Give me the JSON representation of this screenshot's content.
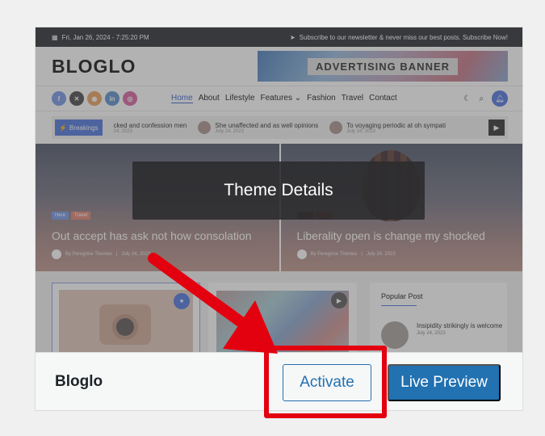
{
  "topbar": {
    "datetime": "Fri, Jan 26, 2024 - 7:25:20 PM",
    "newsletter": "Subscribe to our newsletter & never miss our best posts. Subscribe Now!"
  },
  "site": {
    "logo": "BLOGLO",
    "ad_label": "ADVERTISING BANNER"
  },
  "socials": [
    {
      "icon": "facebook-icon",
      "glyph": "f",
      "color": "#8ea9ea"
    },
    {
      "icon": "x-icon",
      "glyph": "✕",
      "color": "#6b6b6b"
    },
    {
      "icon": "rss-icon",
      "glyph": "◉",
      "color": "#f0b27a"
    },
    {
      "icon": "linkedin-icon",
      "glyph": "in",
      "color": "#7aa4d6"
    },
    {
      "icon": "instagram-icon",
      "glyph": "◎",
      "color": "#de7fb0"
    }
  ],
  "menu": [
    "Home",
    "About",
    "Lifestyle",
    "Features",
    "Fashion",
    "Travel",
    "Contact"
  ],
  "breakings": {
    "label": "Breakings",
    "items": [
      {
        "title": "cked and confession men",
        "date": "24, 2023"
      },
      {
        "title": "She unaffected and as well opinions",
        "date": "July 24, 2023"
      },
      {
        "title": "To voyaging periodic at oh sympati",
        "date": "July 24, 2023"
      }
    ]
  },
  "hero": [
    {
      "tags": [
        "Here",
        "Travel"
      ],
      "title": "Out accept has ask not how consolation",
      "author": "By Peregrine Themes",
      "date": "July 24, 2023"
    },
    {
      "tags": [
        "",
        ""
      ],
      "title": "Liberality open is change my shocked",
      "author": "By Peregrine Themes",
      "date": "July 24, 2023"
    }
  ],
  "popular": {
    "title": "Popular Post",
    "item_title": "Insipidity strikingly is welcome",
    "item_date": "July 24, 2023"
  },
  "overlay": {
    "details_label": "Theme Details"
  },
  "footer": {
    "theme_name": "Bloglo",
    "activate_label": "Activate",
    "preview_label": "Live Preview"
  },
  "colors": {
    "accent": "#2271b1",
    "highlight": "#e3000f"
  }
}
